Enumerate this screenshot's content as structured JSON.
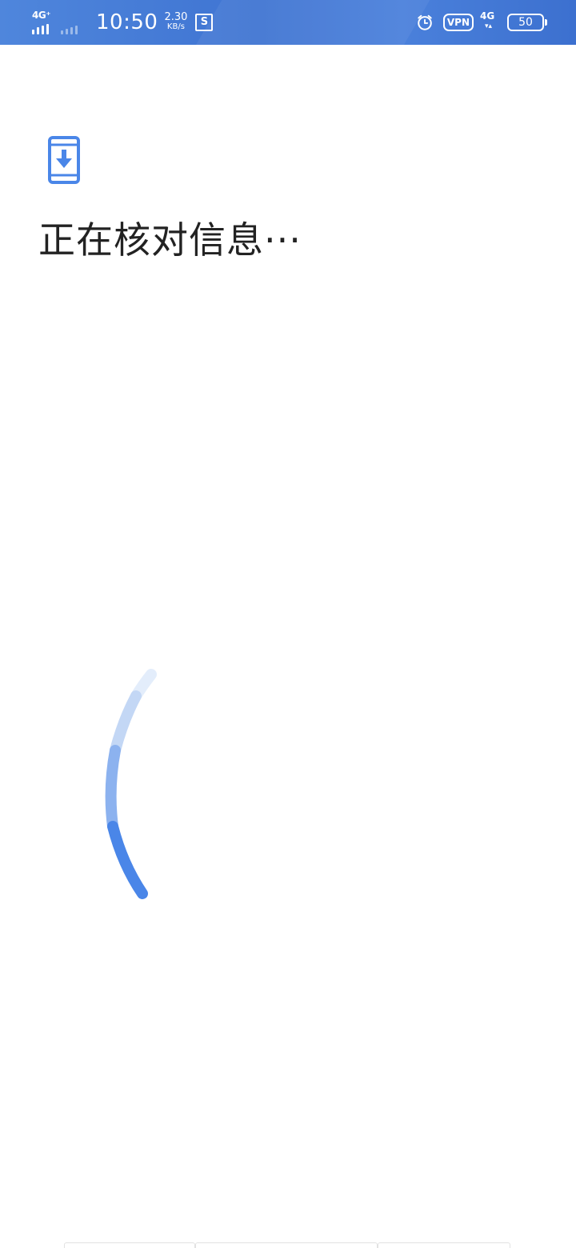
{
  "status_bar": {
    "network_left": "4G⁺",
    "time": "10:50",
    "speed_value": "2.30",
    "speed_unit": "KB/s",
    "screenshot_icon_letter": "S",
    "vpn": "VPN",
    "network_right": "4G",
    "network_right_arrows": "▾▴",
    "battery": "50",
    "icons": [
      "signal-bars-icon",
      "alarm-icon",
      "battery-icon",
      "screenshot-icon"
    ]
  },
  "main": {
    "icon": "phone-download-icon",
    "title": "正在核对信息···",
    "spinner": "loading-spinner"
  },
  "colors": {
    "status_bar": "#4a7fd9",
    "accent": "#4a86e8",
    "text": "#222222",
    "background": "#ffffff"
  }
}
